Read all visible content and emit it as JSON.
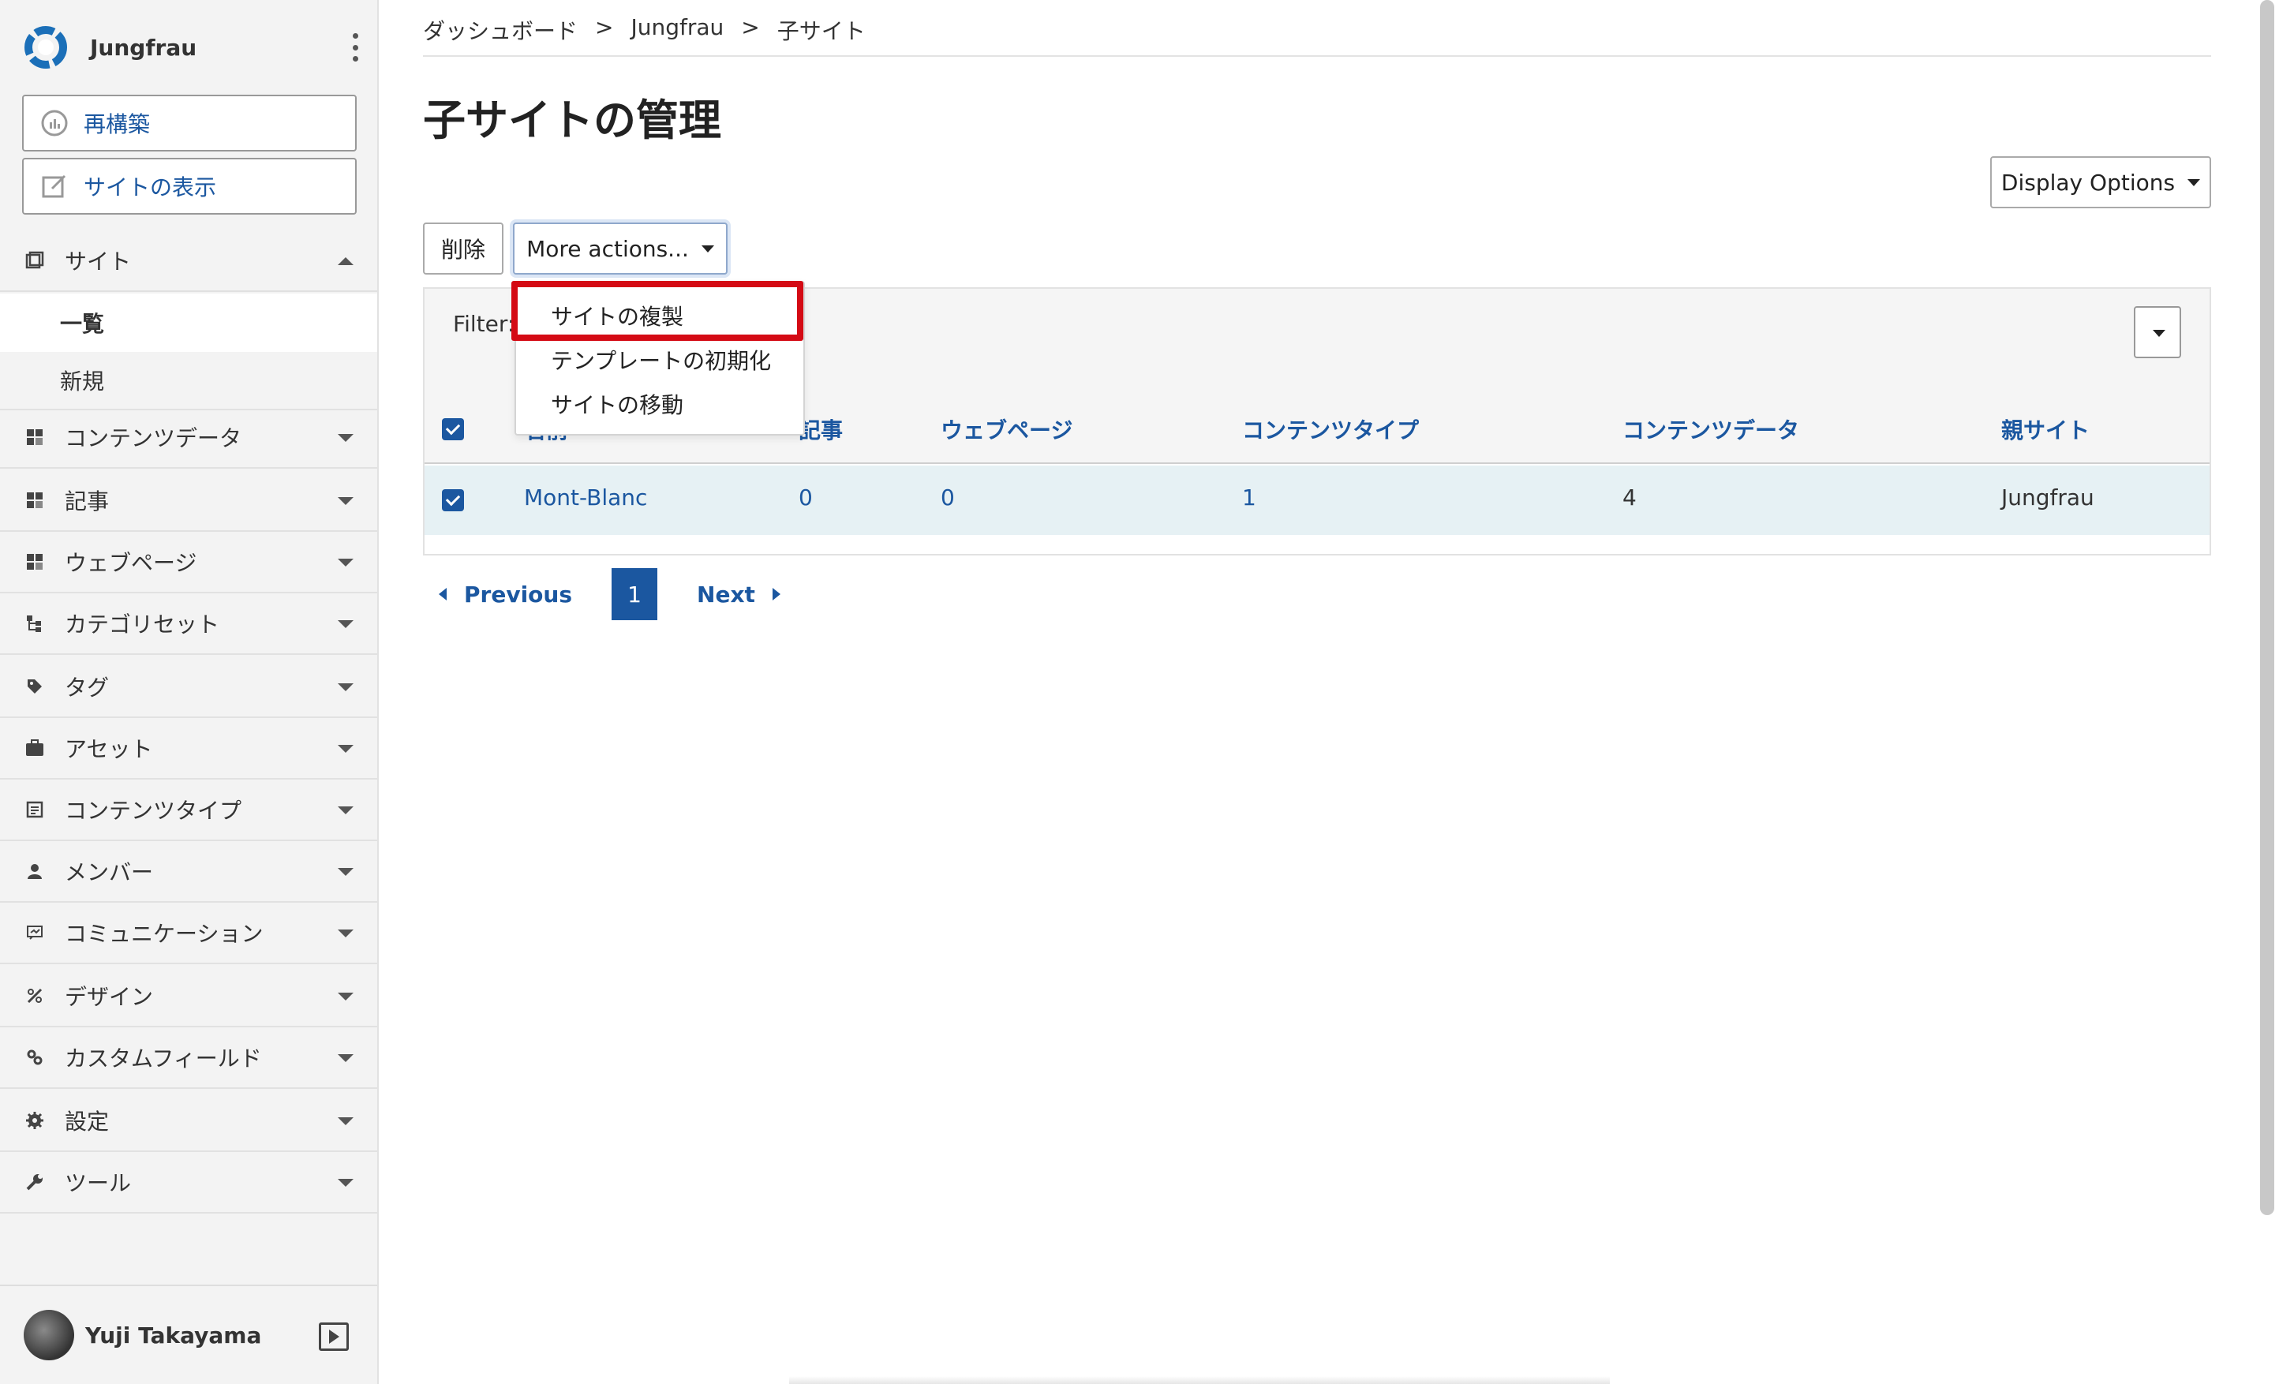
{
  "sidebar": {
    "site_name": "Jungfrau",
    "rebuild_label": "再構築",
    "view_site_label": "サイトの表示",
    "nav": [
      {
        "label": "サイト",
        "icon": "sites-icon"
      },
      {
        "label": "コンテンツデータ",
        "icon": "content-data-icon"
      },
      {
        "label": "記事",
        "icon": "entries-icon"
      },
      {
        "label": "ウェブページ",
        "icon": "pages-icon"
      },
      {
        "label": "カテゴリセット",
        "icon": "category-set-icon"
      },
      {
        "label": "タグ",
        "icon": "tag-icon"
      },
      {
        "label": "アセット",
        "icon": "asset-icon"
      },
      {
        "label": "コンテンツタイプ",
        "icon": "content-type-icon"
      },
      {
        "label": "メンバー",
        "icon": "member-icon"
      },
      {
        "label": "コミュニケーション",
        "icon": "communication-icon"
      },
      {
        "label": "デザイン",
        "icon": "design-icon"
      },
      {
        "label": "カスタムフィールド",
        "icon": "custom-field-icon"
      },
      {
        "label": "設定",
        "icon": "settings-icon"
      },
      {
        "label": "ツール",
        "icon": "tools-icon"
      }
    ],
    "sub_items": [
      {
        "label": "一覧"
      },
      {
        "label": "新規"
      }
    ],
    "user_name": "Yuji Takayama"
  },
  "breadcrumb": {
    "items": [
      "ダッシュボード",
      "Jungfrau",
      "子サイト"
    ],
    "separator": ">"
  },
  "page_title": "子サイトの管理",
  "toolbar": {
    "display_options": "Display Options",
    "delete_label": "削除",
    "more_actions": "More actions..."
  },
  "dropdown": {
    "items": [
      "サイトの複製",
      "テンプレートの初期化",
      "サイトの移動"
    ]
  },
  "filter": {
    "label": "Filter:"
  },
  "table": {
    "columns": [
      "名前",
      "記事",
      "ウェブページ",
      "コンテンツタイプ",
      "コンテンツデータ",
      "親サイト"
    ],
    "rows": [
      {
        "name": "Mont-Blanc",
        "entries": "0",
        "pages": "0",
        "content_types": "1",
        "content_data": "4",
        "parent": "Jungfrau"
      }
    ]
  },
  "pagination": {
    "previous": "Previous",
    "current": "1",
    "next": "Next"
  },
  "colors": {
    "accent": "#1b57a0",
    "highlight": "#d40a14",
    "row_selected": "#e6f1f4"
  }
}
